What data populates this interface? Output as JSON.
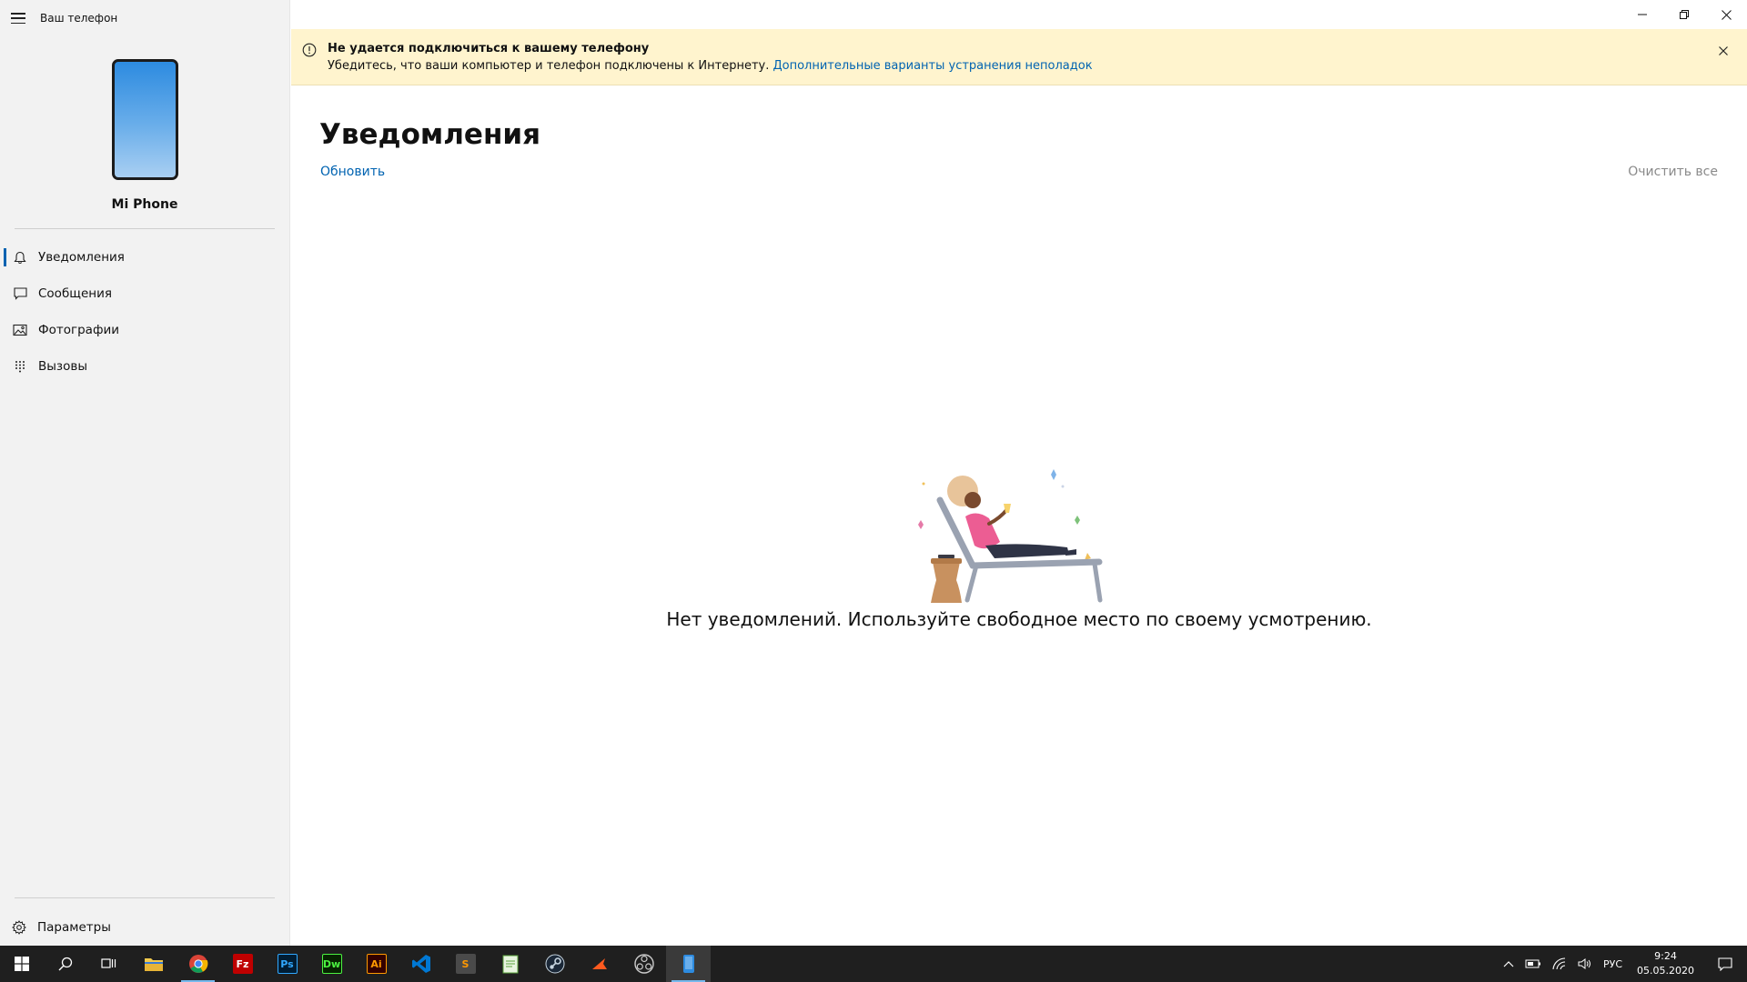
{
  "app": {
    "title": "Ваш телефон"
  },
  "device": {
    "name": "Mi Phone"
  },
  "nav": {
    "notifications": "Уведомления",
    "messages": "Сообщения",
    "photos": "Фотографии",
    "calls": "Вызовы",
    "settings": "Параметры"
  },
  "banner": {
    "title": "Не удается подключиться к вашему телефону",
    "text": "Убедитесь, что ваши компьютер и телефон подключены к Интернету.",
    "link": "Дополнительные варианты устранения неполадок"
  },
  "main": {
    "title": "Уведомления",
    "refresh": "Обновить",
    "clear_all": "Очистить все",
    "empty_message": "Нет уведомлений. Используйте свободное место по своему усмотрению."
  },
  "taskbar": {
    "apps": {
      "photoshop": "Ps",
      "dreamweaver": "Dw",
      "illustrator": "Ai"
    },
    "tray": {
      "language": "РУС",
      "time": "9:24",
      "date": "05.05.2020"
    }
  },
  "colors": {
    "accent": "#0063b1",
    "banner_bg": "#fff4ce",
    "sidebar_bg": "#f2f2f2",
    "taskbar_bg": "#1f1f1f"
  }
}
